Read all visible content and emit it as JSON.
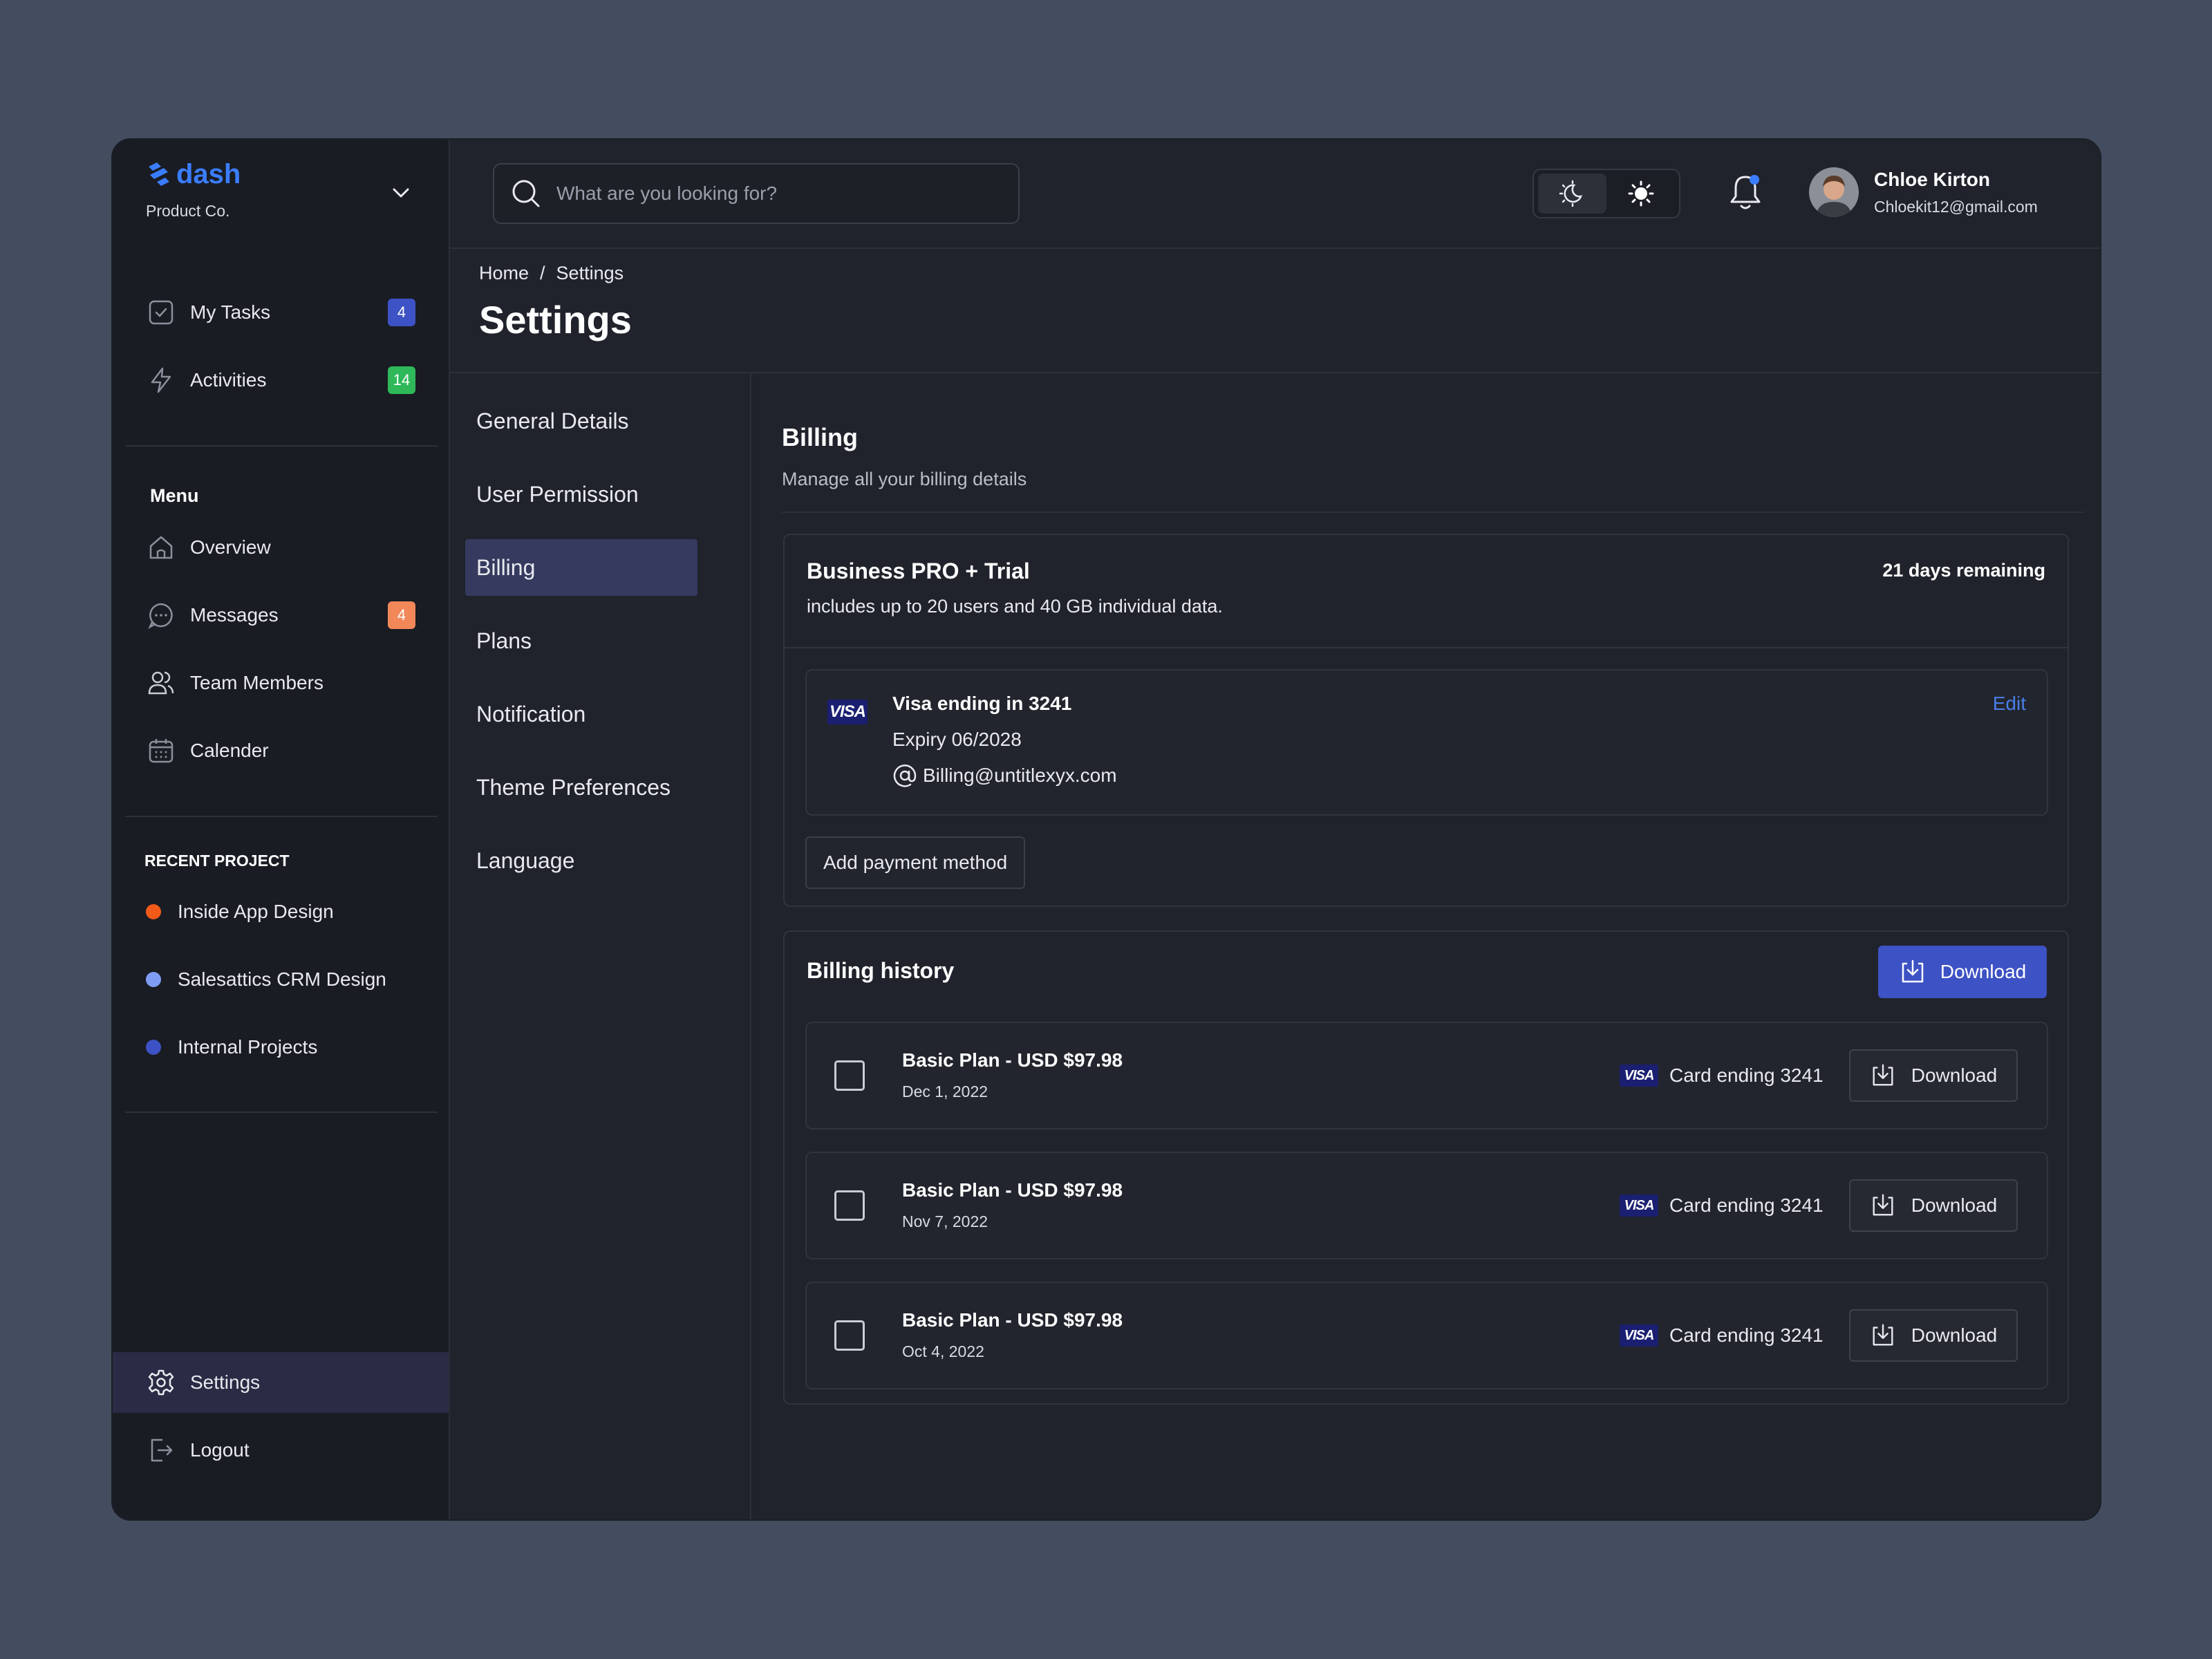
{
  "brand": {
    "name": "dash",
    "company": "Product Co."
  },
  "sidebar": {
    "top_items": [
      {
        "label": "My Tasks",
        "badge": "4",
        "badge_color": "#3d52c4"
      },
      {
        "label": "Activities",
        "badge": "14",
        "badge_color": "#2fb85a"
      }
    ],
    "menu_title": "Menu",
    "menu_items": [
      {
        "label": "Overview"
      },
      {
        "label": "Messages",
        "badge": "4",
        "badge_color": "#f2875a"
      },
      {
        "label": "Team Members"
      },
      {
        "label": "Calender"
      }
    ],
    "recent_title": "RECENT PROJECT",
    "projects": [
      {
        "label": "Inside App Design",
        "color": "#f25a1a"
      },
      {
        "label": "Salesattics CRM Design",
        "color": "#7f9cf5"
      },
      {
        "label": "Internal Projects",
        "color": "#3d52c4"
      }
    ],
    "bottom_items": [
      {
        "label": "Settings"
      },
      {
        "label": "Logout"
      }
    ]
  },
  "header": {
    "search_placeholder": "What are you looking for?",
    "user_name": "Chloe Kirton",
    "user_email": "Chloekit12@gmail.com"
  },
  "breadcrumb": {
    "home": "Home",
    "sep": "/",
    "current": "Settings"
  },
  "page_title": "Settings",
  "settings_nav": [
    {
      "label": "General Details"
    },
    {
      "label": "User Permission"
    },
    {
      "label": "Billing"
    },
    {
      "label": "Plans"
    },
    {
      "label": "Notification"
    },
    {
      "label": "Theme Preferences"
    },
    {
      "label": "Language"
    }
  ],
  "billing": {
    "title": "Billing",
    "subtitle": "Manage all your billing details",
    "plan": {
      "name": "Business PRO + Trial",
      "description": "includes up to 20 users and 40 GB individual data.",
      "remaining": "21 days remaining"
    },
    "card": {
      "brand": "VISA",
      "title": "Visa ending in 3241",
      "expiry": "Expiry 06/2028",
      "email": "Billing@untitlexyx.com",
      "edit_label": "Edit"
    },
    "add_payment_label": "Add payment method",
    "history_title": "Billing history",
    "download_label": "Download",
    "history": [
      {
        "title": "Basic Plan - USD $97.98",
        "date": "Dec 1, 2022",
        "card": "Card ending 3241",
        "download": "Download"
      },
      {
        "title": "Basic Plan - USD $97.98",
        "date": "Nov 7, 2022",
        "card": "Card ending 3241",
        "download": "Download"
      },
      {
        "title": "Basic Plan - USD $97.98",
        "date": "Oct 4, 2022",
        "card": "Card ending 3241",
        "download": "Download"
      }
    ]
  },
  "colors": {
    "accent": "#3d52c4",
    "link": "#4a7ee8",
    "active_bg": "#363a5e"
  }
}
